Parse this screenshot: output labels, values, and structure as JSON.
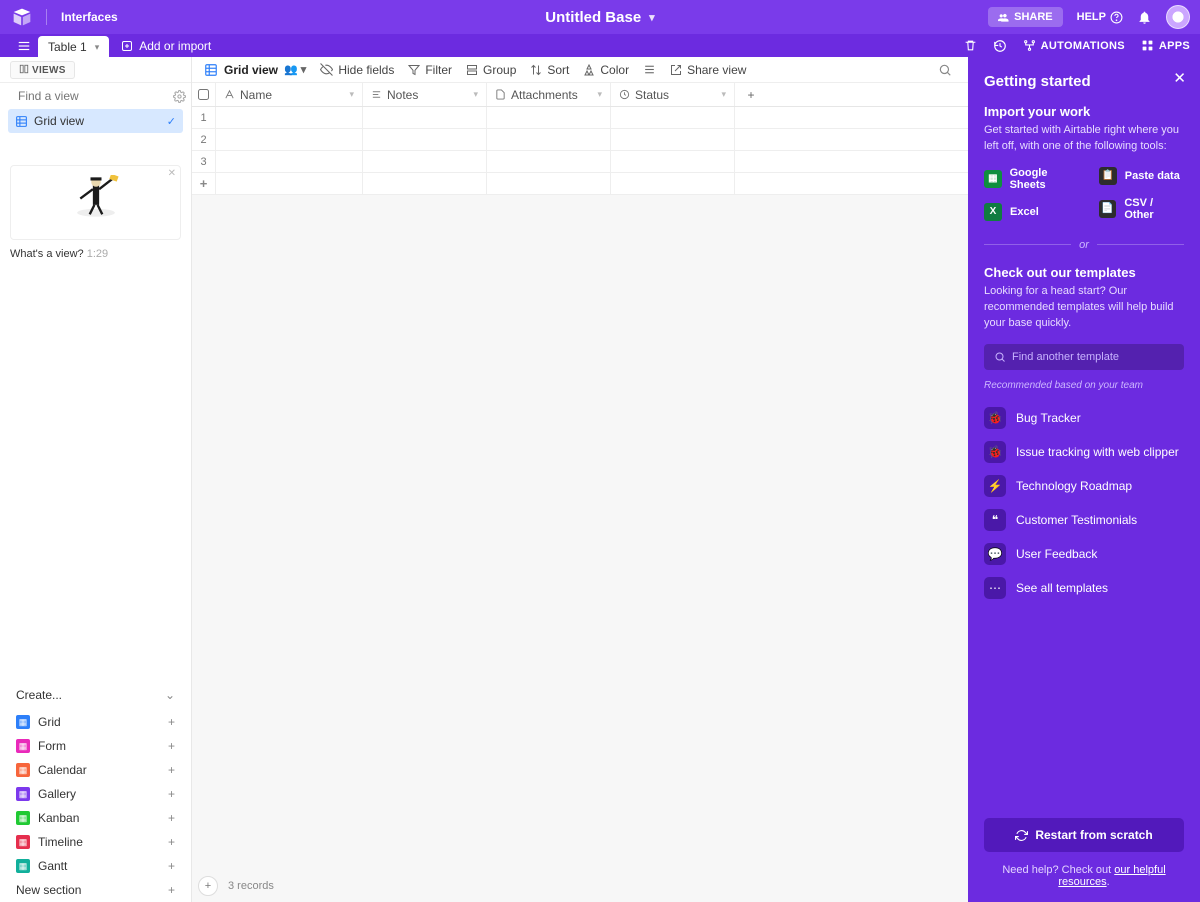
{
  "top": {
    "interfaces": "Interfaces",
    "base_name": "Untitled Base",
    "share": "SHARE",
    "help": "HELP",
    "tab": "Table 1",
    "add_import": "Add or import",
    "automations": "AUTOMATIONS",
    "apps": "APPS"
  },
  "toolbar": {
    "views": "VIEWS",
    "grid_view": "Grid view",
    "hide_fields": "Hide fields",
    "filter": "Filter",
    "group": "Group",
    "sort": "Sort",
    "color": "Color",
    "share_view": "Share view"
  },
  "sidebar": {
    "find_placeholder": "Find a view",
    "active_view": "Grid view",
    "thumb_caption": "What's a view?",
    "thumb_time": "1:29",
    "create": "Create...",
    "rows": [
      {
        "label": "Grid",
        "color": "#2d7ff9"
      },
      {
        "label": "Form",
        "color": "#e929ba"
      },
      {
        "label": "Calendar",
        "color": "#f7653b"
      },
      {
        "label": "Gallery",
        "color": "#7c39ed"
      },
      {
        "label": "Kanban",
        "color": "#20c933"
      },
      {
        "label": "Timeline",
        "color": "#e52e4d"
      },
      {
        "label": "Gantt",
        "color": "#11af9b"
      }
    ],
    "new_section": "New section"
  },
  "columns": [
    "Name",
    "Notes",
    "Attachments",
    "Status"
  ],
  "rows": [
    "1",
    "2",
    "3"
  ],
  "footer_records": "3 records",
  "panel": {
    "title": "Getting started",
    "import_h": "Import your work",
    "import_p": "Get started with Airtable right where you left off, with one of the following tools:",
    "google_sheets": "Google Sheets",
    "paste_data": "Paste data",
    "excel": "Excel",
    "csv": "CSV / Other",
    "or": "or",
    "templates_h": "Check out our templates",
    "templates_p": "Looking for a head start? Our recommended templates will help build your base quickly.",
    "find_tmpl": "Find another template",
    "recommended": "Recommended based on your team",
    "templates": [
      "Bug Tracker",
      "Issue tracking with web clipper",
      "Technology Roadmap",
      "Customer Testimonials",
      "User Feedback",
      "See all templates"
    ],
    "restart": "Restart from scratch",
    "need_help_pre": "Need help? Check out ",
    "need_help_link": "our helpful resources"
  }
}
